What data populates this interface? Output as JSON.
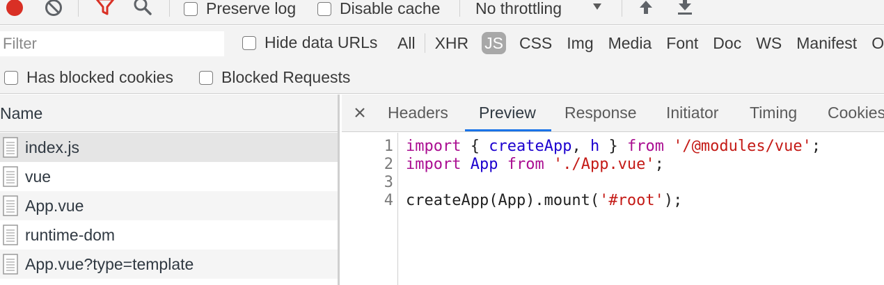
{
  "toolbar": {
    "preserve_log": "Preserve log",
    "disable_cache": "Disable cache",
    "throttling": "No throttling"
  },
  "filterbar": {
    "filter_placeholder": "Filter",
    "hide_data_urls": "Hide data URLs",
    "types": [
      "All",
      "XHR",
      "JS",
      "CSS",
      "Img",
      "Media",
      "Font",
      "Doc",
      "WS",
      "Manifest",
      "O"
    ],
    "active_type": "JS"
  },
  "blockedbar": {
    "has_blocked_cookies": "Has blocked cookies",
    "blocked_requests": "Blocked Requests"
  },
  "requests": {
    "column_name": "Name",
    "items": [
      "index.js",
      "vue",
      "App.vue",
      "runtime-dom",
      "App.vue?type=template"
    ]
  },
  "details": {
    "tabs": [
      "Headers",
      "Preview",
      "Response",
      "Initiator",
      "Timing",
      "Cookies"
    ],
    "active_tab": "Preview",
    "line_numbers": [
      "1",
      "2",
      "3",
      "4"
    ],
    "code": {
      "l1": {
        "kw1": "import",
        "p1": " { ",
        "id1": "createApp",
        "p2": ", ",
        "id2": "h",
        "p3": " } ",
        "kw2": "from",
        "p4": " ",
        "str": "'/@modules/vue'",
        "p5": ";"
      },
      "l2": {
        "kw1": "import",
        "p1": " ",
        "id1": "App",
        "p2": " ",
        "kw2": "from",
        "p3": " ",
        "str": "'./App.vue'",
        "p4": ";"
      },
      "l4": {
        "p1": "createApp(App).mount(",
        "str": "'#root'",
        "p2": ");"
      }
    }
  },
  "colors": {
    "record": "#d93025",
    "filter_active": "#d93025",
    "tab_underline": "#1a73e8",
    "keyword": "#aa0d91",
    "identifier": "#1c00cf",
    "string": "#c41a16"
  },
  "icons": {
    "record": "record-icon",
    "clear": "clear-icon",
    "filter": "filter-icon",
    "search": "search-icon",
    "upload": "import-har-icon",
    "download": "export-har-icon",
    "close": "close-icon",
    "file": "file-icon"
  }
}
